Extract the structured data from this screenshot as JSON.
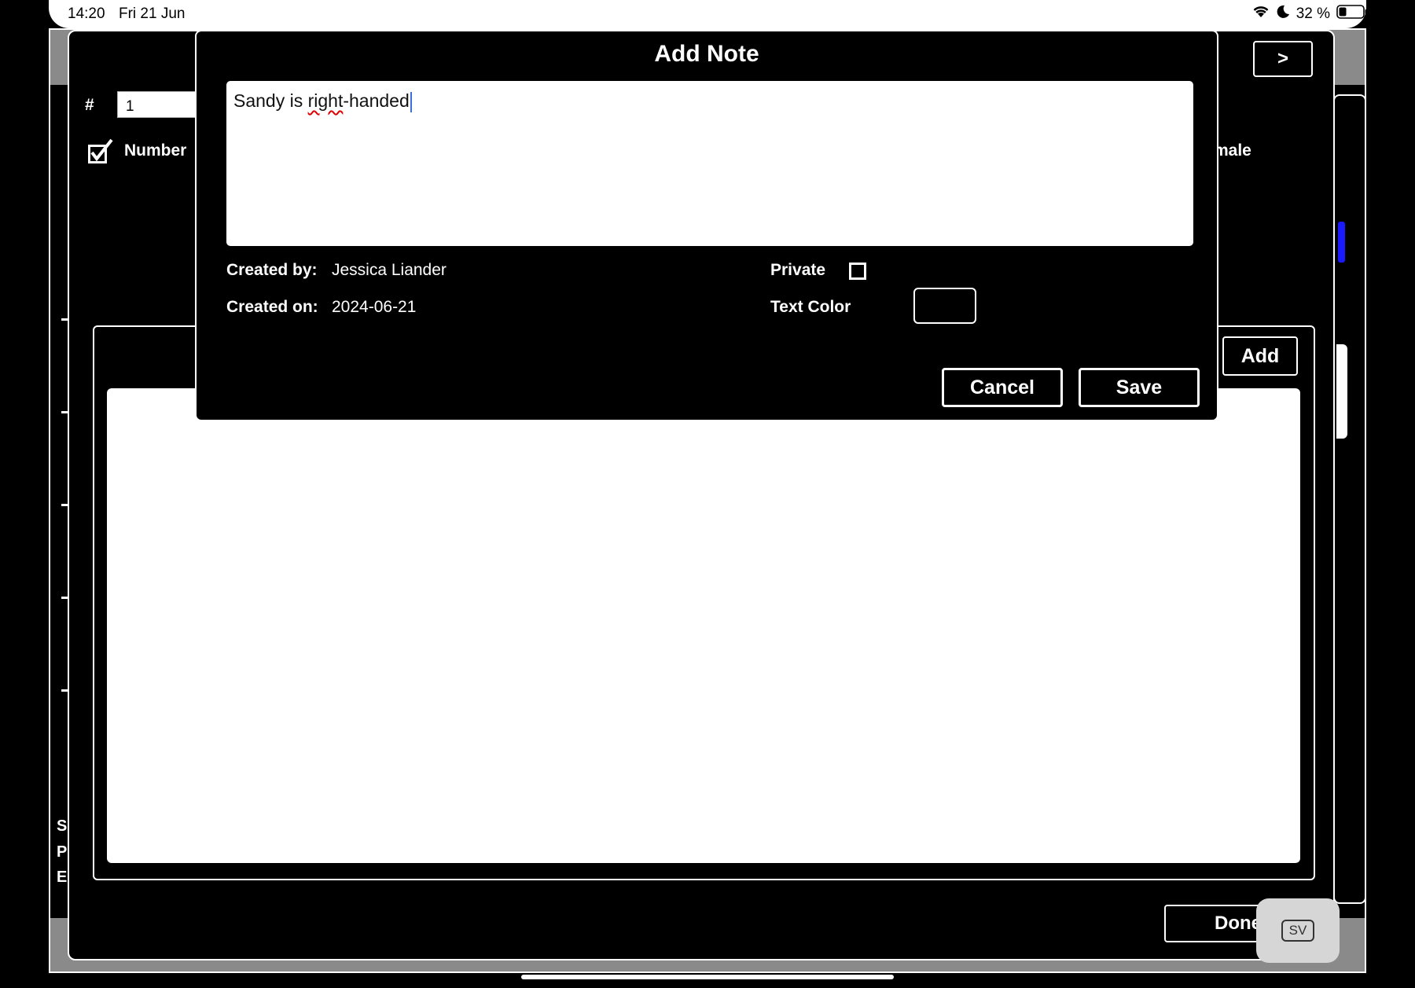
{
  "status_bar": {
    "time": "14:20",
    "date": "Fri 21 Jun",
    "battery": "32 %"
  },
  "background": {
    "hash_label": "#",
    "number_value": "1",
    "number_label": "Number",
    "male_label": "male",
    "next_button": ">",
    "add_button": "Add",
    "done_button": "Done",
    "sv_badge": "SV",
    "left_letters": [
      "S",
      "P",
      "E"
    ]
  },
  "modal": {
    "title": "Add Note",
    "note_text_before": "Sandy is ",
    "note_text_misspelled": "right",
    "note_text_after": "-handed",
    "created_by_label": "Created by:",
    "created_by_value": "Jessica Liander",
    "created_on_label": "Created on:",
    "created_on_value": "2024-06-21",
    "private_label": "Private",
    "private_checked": false,
    "text_color_label": "Text Color",
    "text_color_value": "#000000",
    "cancel_label": "Cancel",
    "save_label": "Save"
  }
}
